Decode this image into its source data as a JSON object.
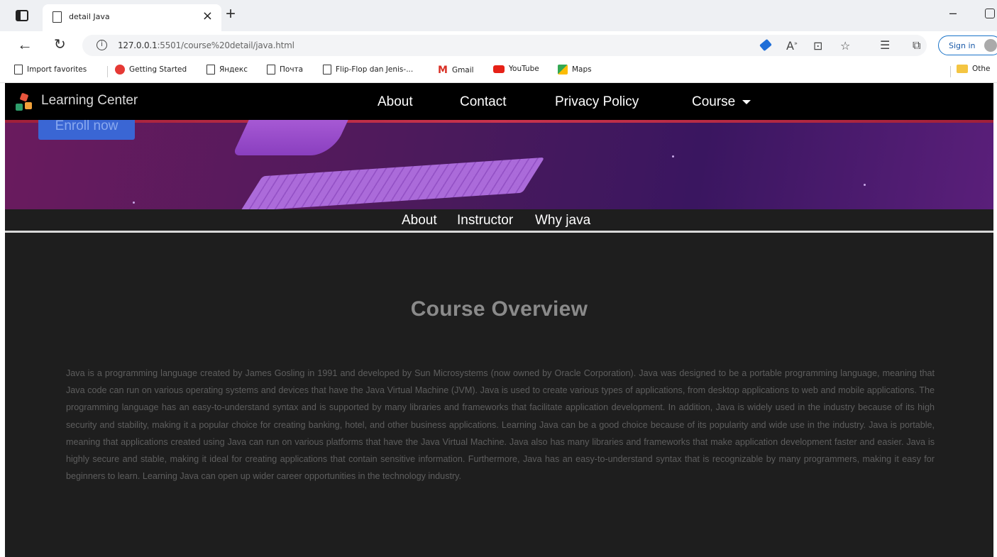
{
  "browser": {
    "tab_title": "detail Java",
    "tab_close": "×",
    "new_tab": "+",
    "minimize": "–",
    "url_host": "127.0.0.1",
    "url_rest": ":5501/course%20detail/java.html",
    "sign_in": "Sign in",
    "icons": [
      "back-arrow-icon",
      "refresh-icon",
      "info-icon",
      "tag-icon",
      "read-aloud-icon",
      "immersive-reader-icon",
      "add-favorite-icon",
      "favorites-icon",
      "collections-icon"
    ],
    "favorites": [
      {
        "label": "Import favorites",
        "icon": "import-icon"
      },
      {
        "label": "Getting Started",
        "icon": "opera-icon"
      },
      {
        "label": "Яндекс",
        "icon": "page-icon"
      },
      {
        "label": "Почта",
        "icon": "page-icon"
      },
      {
        "label": "Flip-Flop dan Jenis-...",
        "icon": "page-icon"
      },
      {
        "label": "Gmail",
        "icon": "gmail-icon"
      },
      {
        "label": "YouTube",
        "icon": "youtube-icon"
      },
      {
        "label": "Maps",
        "icon": "maps-icon"
      }
    ],
    "other_favorites": "Othe"
  },
  "site": {
    "brand": "Learning Center",
    "nav": [
      "About",
      "Contact",
      "Privacy Policy",
      "Course"
    ],
    "enroll_button": "Enroll now",
    "subnav": [
      "About",
      "Instructor",
      "Why java"
    ],
    "overview_title": "Course Overview",
    "overview_text": "Java is a programming language created by James Gosling in 1991 and developed by Sun Microsystems (now owned by Oracle Corporation). Java was designed to be a portable programming language, meaning that Java code can run on various operating systems and devices that have the Java Virtual Machine (JVM). Java is used to create various types of applications, from desktop applications to web and mobile applications. The programming language has an easy-to-understand syntax and is supported by many libraries and frameworks that facilitate application development. In addition, Java is widely used in the industry because of its high security and stability, making it a popular choice for creating banking, hotel, and other business applications. Learning Java can be a good choice because of its popularity and wide use in the industry. Java is portable, meaning that applications created using Java can run on various platforms that have the Java Virtual Machine. Java also has many libraries and frameworks that make application development faster and easier. Java is highly secure and stable, making it ideal for creating applications that contain sensitive information. Furthermore, Java has an easy-to-understand syntax that is recognizable by many programmers, making it easy for beginners to learn. Learning Java can open up wider career opportunities in the technology industry."
  },
  "colors": {
    "navbar": "#000000",
    "page_bg": "#1e1e1e",
    "enroll": "#3a66d4",
    "hero_purple": "#4a1a5c"
  }
}
